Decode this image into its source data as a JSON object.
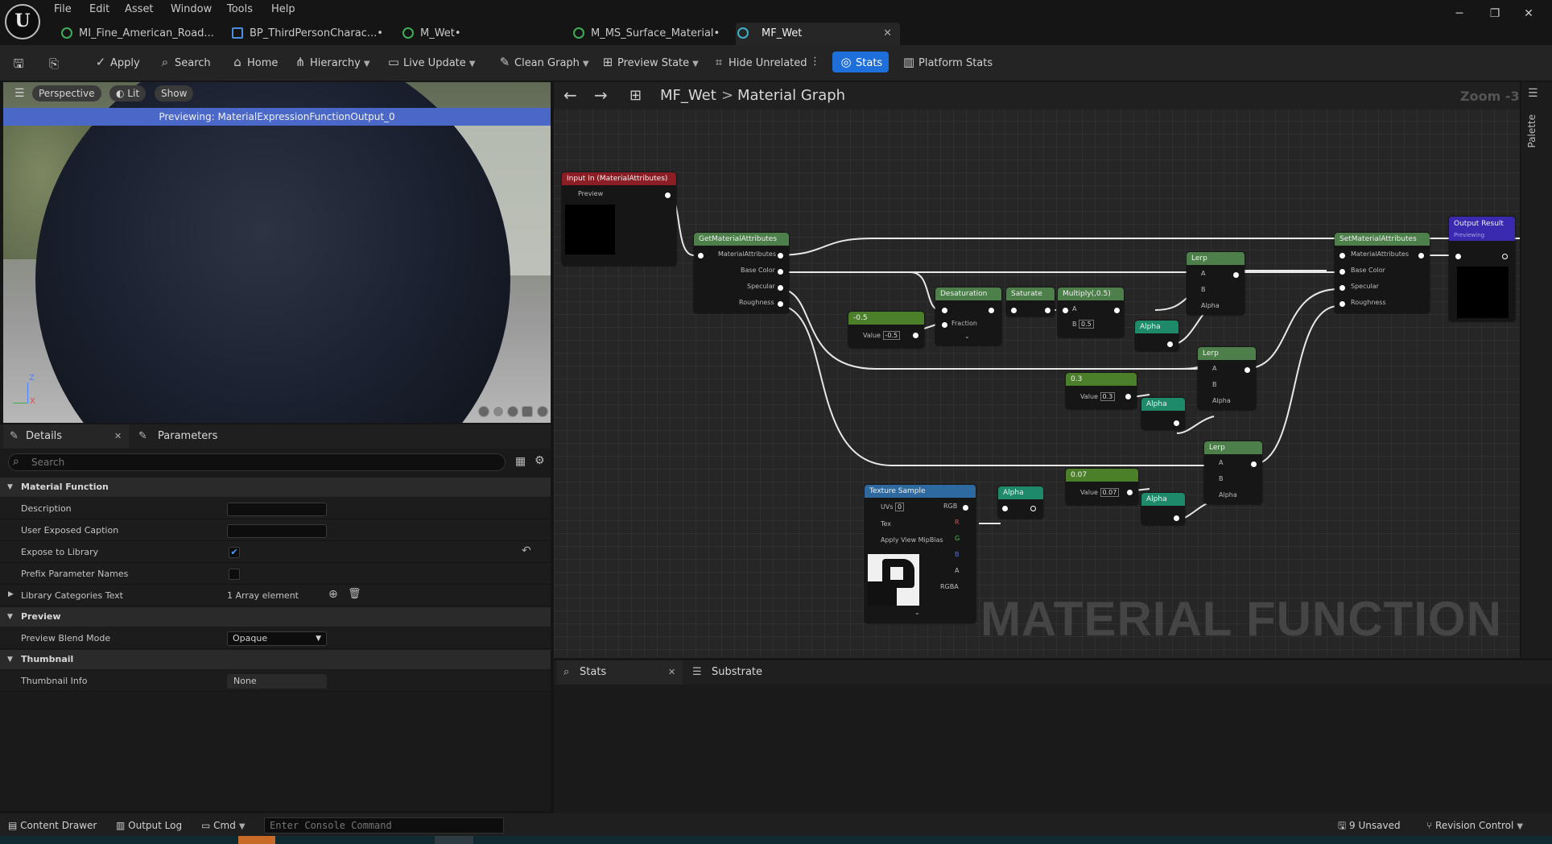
{
  "menu": [
    "File",
    "Edit",
    "Asset",
    "Window",
    "Tools",
    "Help"
  ],
  "tabs": [
    {
      "label": "MI_Fine_American_Road..."
    },
    {
      "label": "BP_ThirdPersonCharac...•"
    },
    {
      "label": "M_Wet•"
    },
    {
      "label": "M_MS_Surface_Material•"
    },
    {
      "label": "MF_Wet"
    }
  ],
  "toolbar": {
    "apply": "Apply",
    "search": "Search",
    "home": "Home",
    "hierarchy": "Hierarchy",
    "live_update": "Live Update",
    "clean_graph": "Clean Graph",
    "preview_state": "Preview State",
    "hide_unrelated": "Hide Unrelated",
    "stats": "Stats",
    "platform_stats": "Platform Stats"
  },
  "viewport": {
    "perspective": "Perspective",
    "lit": "Lit",
    "show": "Show",
    "banner": "Previewing: MaterialExpressionFunctionOutput_0",
    "axis_z": "Z",
    "axis_x": "X"
  },
  "details": {
    "tab_details": "Details",
    "tab_parameters": "Parameters",
    "search_placeholder": "Search",
    "sec_material_function": "Material Function",
    "description": "Description",
    "user_exposed_caption": "User Exposed Caption",
    "expose_to_library": "Expose to Library",
    "prefix_parameter_names": "Prefix Parameter Names",
    "library_categories_text": "Library Categories Text",
    "library_categories_value": "1 Array element",
    "sec_preview": "Preview",
    "preview_blend_mode": "Preview Blend Mode",
    "preview_blend_value": "Opaque",
    "sec_thumbnail": "Thumbnail",
    "thumbnail_info": "Thumbnail Info",
    "thumbnail_value": "None"
  },
  "graph": {
    "crumb_root": "MF_Wet",
    "crumb_sep": ">",
    "crumb_leaf": "Material Graph",
    "zoom": "Zoom -3",
    "palette": "Palette",
    "watermark": "MATERIAL FUNCTION",
    "nodes": {
      "input": "Input In (MaterialAttributes)",
      "input_preview": "Preview",
      "get": "GetMaterialAttributes",
      "get_ma": "MaterialAttributes",
      "get_bc": "Base Color",
      "get_spec": "Specular",
      "get_rough": "Roughness",
      "neg05": "-0.5",
      "neg05_value_lbl": "Value",
      "neg05_value": "-0.5",
      "desat": "Desaturation",
      "desat_frac": "Fraction",
      "saturate": "Saturate",
      "multiply": "Multiply(,0.5)",
      "mul_a": "A",
      "mul_b": "B",
      "mul_b_val": "0.5",
      "lerp": "Lerp",
      "lerp_a": "A",
      "lerp_b": "B",
      "lerp_alpha": "Alpha",
      "alpha": "Alpha",
      "c03": "0.3",
      "c03_lbl": "Value",
      "c03_val": "0.3",
      "c007": "0.07",
      "c007_lbl": "Value",
      "c007_val": "0.07",
      "tex": "Texture Sample",
      "tex_uvs": "UVs",
      "tex_uvs_val": "0",
      "tex_tex": "Tex",
      "tex_mip": "Apply View MipBias",
      "tex_rgb": "RGB",
      "tex_r": "R",
      "tex_g": "G",
      "tex_b": "B",
      "tex_a": "A",
      "tex_rgba": "RGBA",
      "set": "SetMaterialAttributes",
      "set_ma": "MaterialAttributes",
      "set_bc": "Base Color",
      "set_spec": "Specular",
      "set_rough": "Roughness",
      "output": "Output Result",
      "output_sub": "Previewing"
    }
  },
  "bottom": {
    "stats": "Stats",
    "substrate": "Substrate"
  },
  "status": {
    "content_drawer": "Content Drawer",
    "output_log": "Output Log",
    "cmd": "Cmd",
    "console_placeholder": "Enter Console Command",
    "unsaved": "9 Unsaved",
    "revision": "Revision Control"
  }
}
